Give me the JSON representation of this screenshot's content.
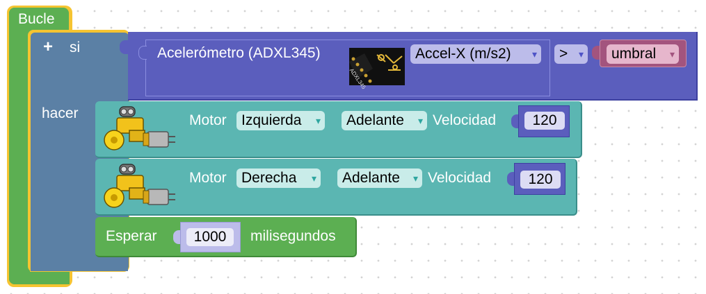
{
  "loop": {
    "label": "Bucle"
  },
  "if_block": {
    "add_symbol": "+",
    "if_label": "si",
    "do_label": "hacer"
  },
  "condition": {
    "sensor_label": "Acelerómetro (ADXL345)",
    "sensor_chip_text": "ADXL345",
    "axis": "Accel-X (m/s2)",
    "operator": ">",
    "variable": "umbral"
  },
  "motors": [
    {
      "label": "Motor",
      "side": "Izquierda",
      "direction": "Adelante",
      "speed_label": "Velocidad",
      "speed": "120"
    },
    {
      "label": "Motor",
      "side": "Derecha",
      "direction": "Adelante",
      "speed_label": "Velocidad",
      "speed": "120"
    }
  ],
  "wait": {
    "label": "Esperar",
    "value": "1000",
    "unit": "milisegundos"
  },
  "dropdown_arrow": "▾",
  "colors": {
    "loop_green": "#5caf52",
    "highlight_yellow": "#f5c431",
    "if_blue": "#5b80a5",
    "sensor_purple": "#5b5ebd",
    "motor_teal": "#5bb6b2",
    "variable_pink": "#a3547e"
  }
}
